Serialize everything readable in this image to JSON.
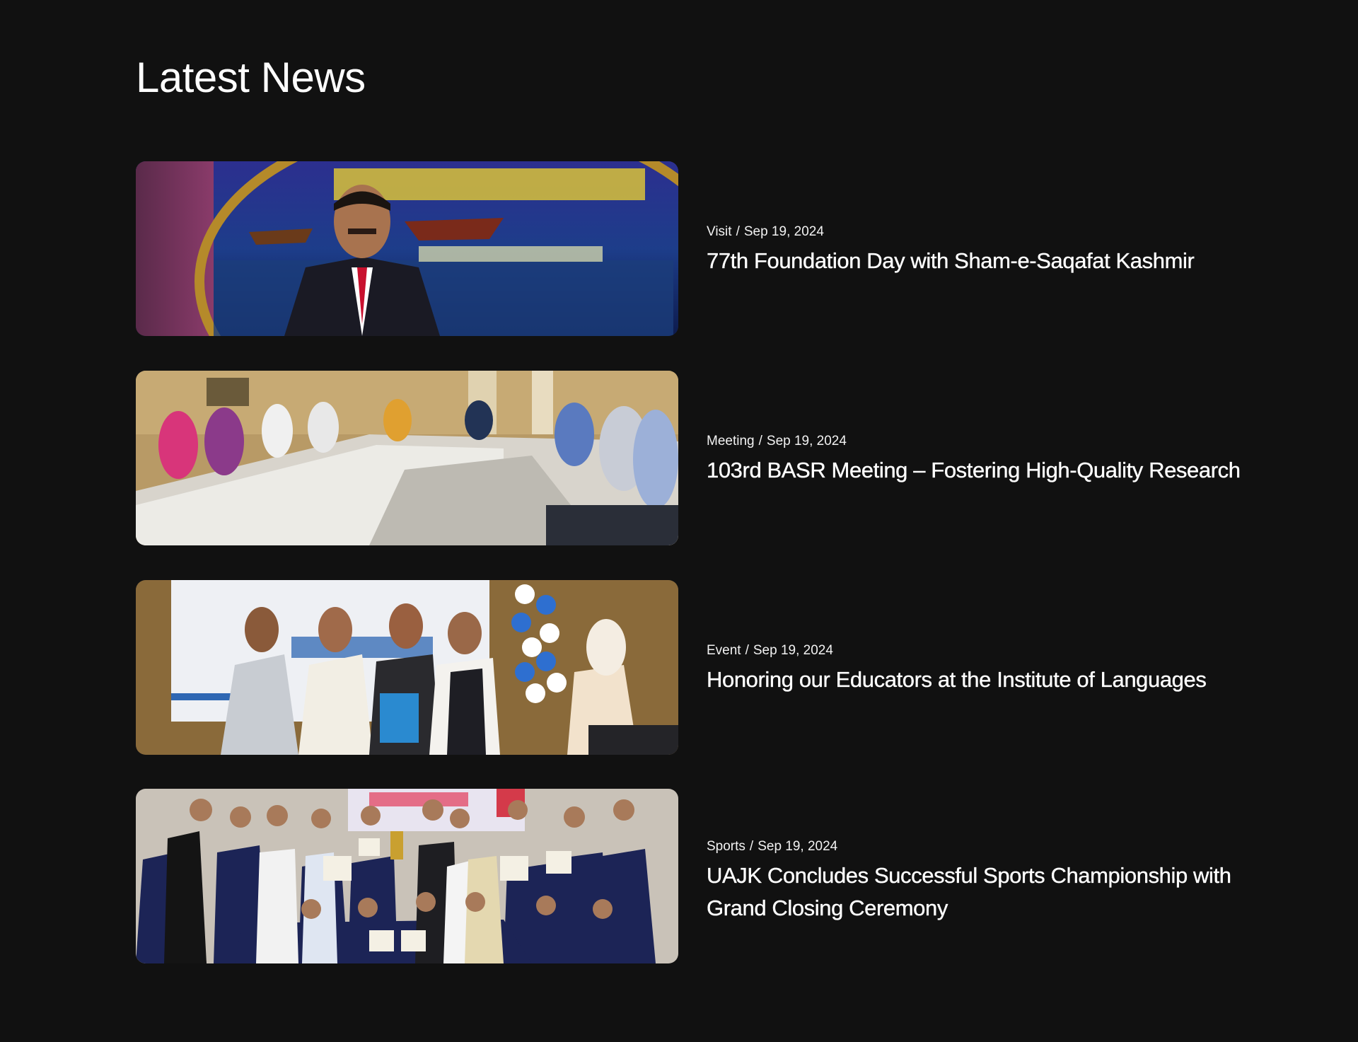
{
  "section": {
    "title": "Latest News"
  },
  "news": [
    {
      "category": "Visit",
      "date": "Sep 19, 2024",
      "title": "77th Foundation Day with Sham-e-Saqafat Kashmir"
    },
    {
      "category": "Meeting",
      "date": "Sep 19, 2024",
      "title": "103rd BASR Meeting – Fostering High-Quality Research"
    },
    {
      "category": "Event",
      "date": "Sep 19, 2024",
      "title": "Honoring our Educators at the Institute of Languages"
    },
    {
      "category": "Sports",
      "date": "Sep 19, 2024",
      "title": "UAJK Concludes Successful Sports Championship with Grand Closing Ceremony"
    }
  ],
  "colors": {
    "background": "#111111",
    "text": "#ffffff"
  }
}
